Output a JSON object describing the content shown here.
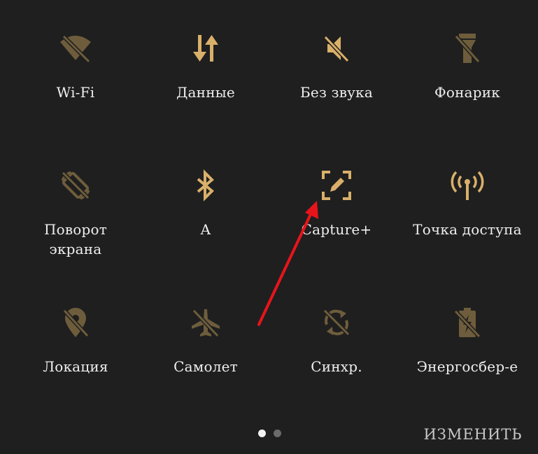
{
  "colors": {
    "background": "#1f1f1f",
    "icon_active": "#d9b06a",
    "icon_inactive": "#6e5d3c",
    "label": "#efefef",
    "annotation_arrow": "#e8141b"
  },
  "quick_settings": {
    "tiles": [
      {
        "label": "Wi-Fi",
        "icon": "wifi-off-icon",
        "state": "inactive"
      },
      {
        "label": "Данные",
        "icon": "mobile-data-icon",
        "state": "active"
      },
      {
        "label": "Без звука",
        "icon": "mute-icon",
        "state": "active"
      },
      {
        "label": "Фонарик",
        "icon": "flashlight-off-icon",
        "state": "inactive"
      },
      {
        "label": "Поворот\nэкрана",
        "icon": "rotation-off-icon",
        "state": "inactive"
      },
      {
        "label": "A",
        "icon": "bluetooth-icon",
        "state": "active"
      },
      {
        "label": "Capture+",
        "icon": "capture-plus-icon",
        "state": "active"
      },
      {
        "label": "Точка доступа",
        "icon": "hotspot-icon",
        "state": "active"
      },
      {
        "label": "Локация",
        "icon": "location-off-icon",
        "state": "inactive"
      },
      {
        "label": "Самолет",
        "icon": "airplane-off-icon",
        "state": "inactive"
      },
      {
        "label": "Синхр.",
        "icon": "sync-off-icon",
        "state": "inactive"
      },
      {
        "label": "Энергосбер-е",
        "icon": "battery-saver-off-icon",
        "state": "inactive"
      }
    ]
  },
  "pager": {
    "pages": 2,
    "current": 1
  },
  "edit_button": {
    "label": "ИЗМЕНИТЬ"
  }
}
